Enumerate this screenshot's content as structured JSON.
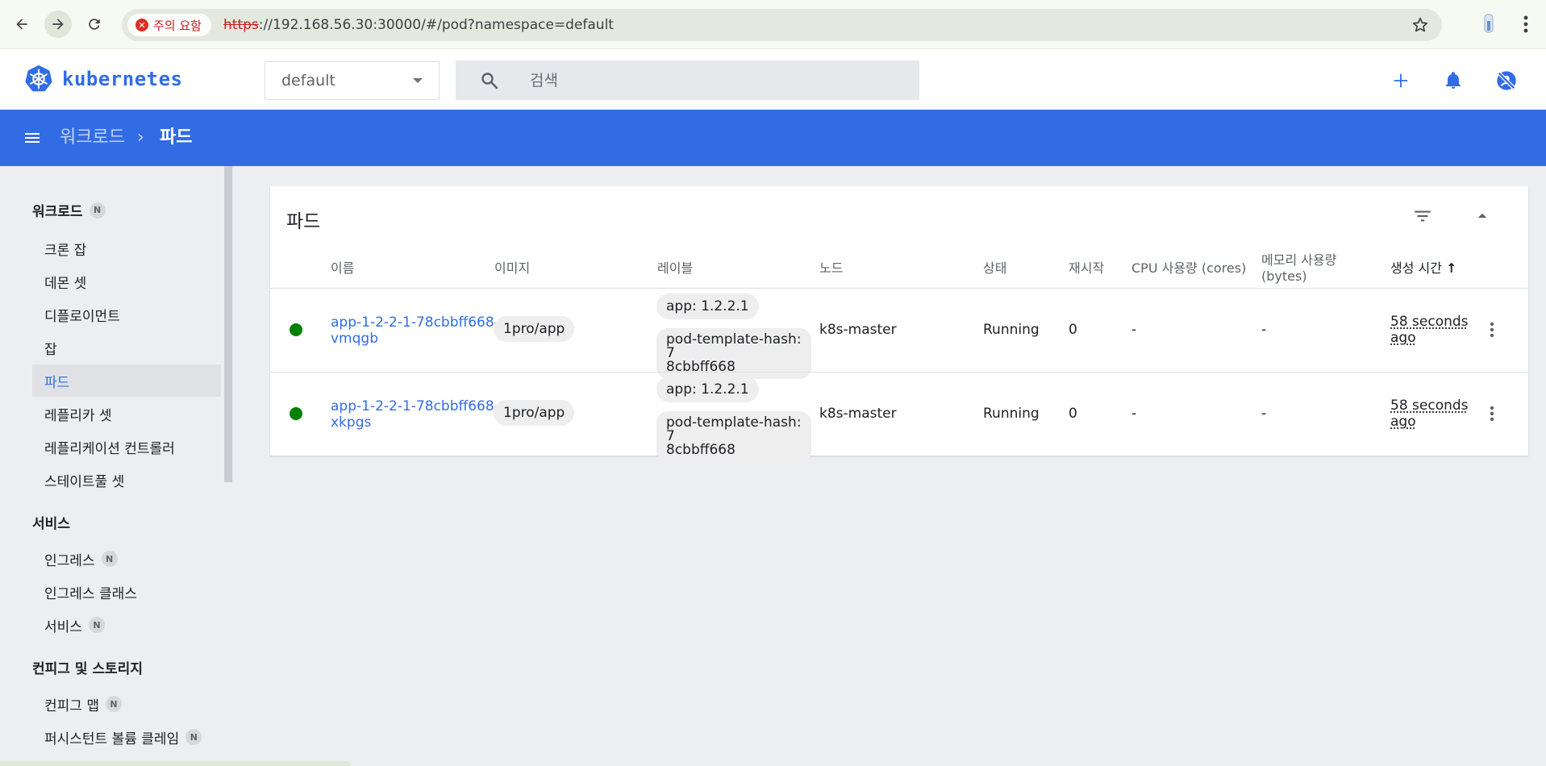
{
  "browser": {
    "security_label": "주의 요함",
    "url_scheme": "https",
    "url_rest": "://192.168.56.30:30000/#/pod?namespace=default"
  },
  "header": {
    "logo_text": "kubernetes",
    "namespace": "default",
    "search_placeholder": "검색"
  },
  "breadcrumb": {
    "parent": "워크로드",
    "separator": "›",
    "current": "파드"
  },
  "sidebar": {
    "badge": "N",
    "sections": [
      {
        "title": "워크로드",
        "items": [
          "크론 잡",
          "데몬 셋",
          "디플로이먼트",
          "잡",
          "파드",
          "레플리카 셋",
          "레플리케이션 컨트롤러",
          "스테이트풀 셋"
        ]
      },
      {
        "title": "서비스",
        "items": [
          "인그레스",
          "인그레스 클래스",
          "서비스"
        ]
      },
      {
        "title": "컨피그 및 스토리지",
        "items": [
          "컨피그 맵",
          "퍼시스턴트 볼륨 클레임"
        ]
      }
    ],
    "active_item": "파드"
  },
  "card": {
    "title": "파드",
    "columns": [
      "이름",
      "이미지",
      "레이블",
      "노드",
      "상태",
      "재시작",
      "CPU 사용량 (cores)",
      "메모리 사용량",
      "(bytes)",
      "생성 시간"
    ],
    "sort_indicator": "↑",
    "rows": [
      {
        "name_line1": "app-1-2-2-1-78cbbff668-",
        "name_line2": "vmqgb",
        "image": "1pro/app",
        "label1": "app: 1.2.2.1",
        "label2_line1": "pod-template-hash: 7",
        "label2_line2": "8cbbff668",
        "node": "k8s-master",
        "status": "Running",
        "restarts": "0",
        "cpu": "-",
        "memory": "-",
        "age_line1": "58 seconds",
        "age_line2": "ago"
      },
      {
        "name_line1": "app-1-2-2-1-78cbbff668-",
        "name_line2": "xkpgs",
        "image": "1pro/app",
        "label1": "app: 1.2.2.1",
        "label2_line1": "pod-template-hash: 7",
        "label2_line2": "8cbbff668",
        "node": "k8s-master",
        "status": "Running",
        "restarts": "0",
        "cpu": "-",
        "memory": "-",
        "age_line1": "58 seconds",
        "age_line2": "ago"
      }
    ]
  },
  "colors": {
    "brand": "#326ce5",
    "status_running": "#008000",
    "warning": "#c5221f"
  },
  "icons": [
    "back-icon",
    "forward-icon",
    "reload-icon",
    "star-icon",
    "kubernetes-logo-icon",
    "search-icon",
    "plus-icon",
    "bell-icon",
    "user-off-icon",
    "menu-icon",
    "filter-icon",
    "collapse-icon",
    "more-vert-icon"
  ]
}
